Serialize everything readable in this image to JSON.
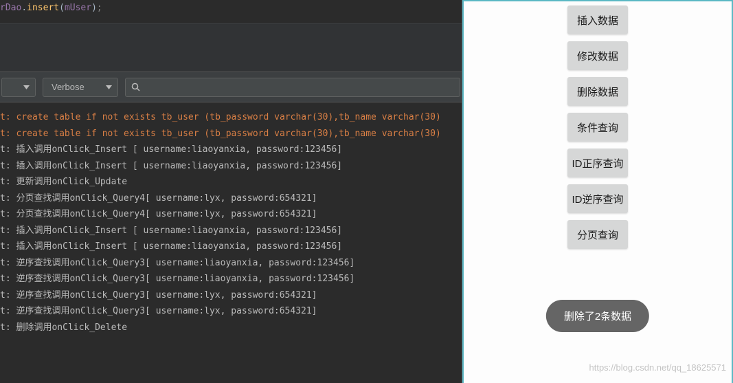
{
  "code": {
    "line1_parts": [
      "rDao",
      ".",
      "insert",
      "(",
      "mUser",
      ")",
      ";"
    ]
  },
  "filter": {
    "verbose_label": "Verbose",
    "search_placeholder": ""
  },
  "logs": [
    {
      "color": "orange",
      "text": "t: create table if not exists tb_user (tb_password varchar(30),tb_name varchar(30)"
    },
    {
      "color": "orange",
      "text": "t: create table if not exists tb_user (tb_password varchar(30),tb_name varchar(30)"
    },
    {
      "color": "gray",
      "text": "t: 插入调用onClick_Insert [ username:liaoyanxia, password:123456]"
    },
    {
      "color": "gray",
      "text": "t: 插入调用onClick_Insert [ username:liaoyanxia, password:123456]"
    },
    {
      "color": "gray",
      "text": "t: 更新调用onClick_Update"
    },
    {
      "color": "gray",
      "text": "t: 分页查找调用onClick_Query4[ username:lyx, password:654321]"
    },
    {
      "color": "gray",
      "text": "t: 分页查找调用onClick_Query4[ username:lyx, password:654321]"
    },
    {
      "color": "gray",
      "text": "t: 插入调用onClick_Insert [ username:liaoyanxia, password:123456]"
    },
    {
      "color": "gray",
      "text": "t: 插入调用onClick_Insert [ username:liaoyanxia, password:123456]"
    },
    {
      "color": "gray",
      "text": "t: 逆序查找调用onClick_Query3[ username:liaoyanxia, password:123456]"
    },
    {
      "color": "gray",
      "text": "t: 逆序查找调用onClick_Query3[ username:liaoyanxia, password:123456]"
    },
    {
      "color": "gray",
      "text": "t: 逆序查找调用onClick_Query3[ username:lyx, password:654321]"
    },
    {
      "color": "gray",
      "text": "t: 逆序查找调用onClick_Query3[ username:lyx, password:654321]"
    },
    {
      "color": "gray",
      "text": "t: 删除调用onClick_Delete"
    }
  ],
  "phone": {
    "buttons": [
      {
        "label": "插入数据"
      },
      {
        "label": "修改数据"
      },
      {
        "label": "删除数据"
      },
      {
        "label": "条件查询"
      },
      {
        "label": "ID正序查询"
      },
      {
        "label": "ID逆序查询"
      },
      {
        "label": "分页查询"
      }
    ],
    "toast": "删除了2条数据"
  },
  "watermark": "https://blog.csdn.net/qq_18625571"
}
